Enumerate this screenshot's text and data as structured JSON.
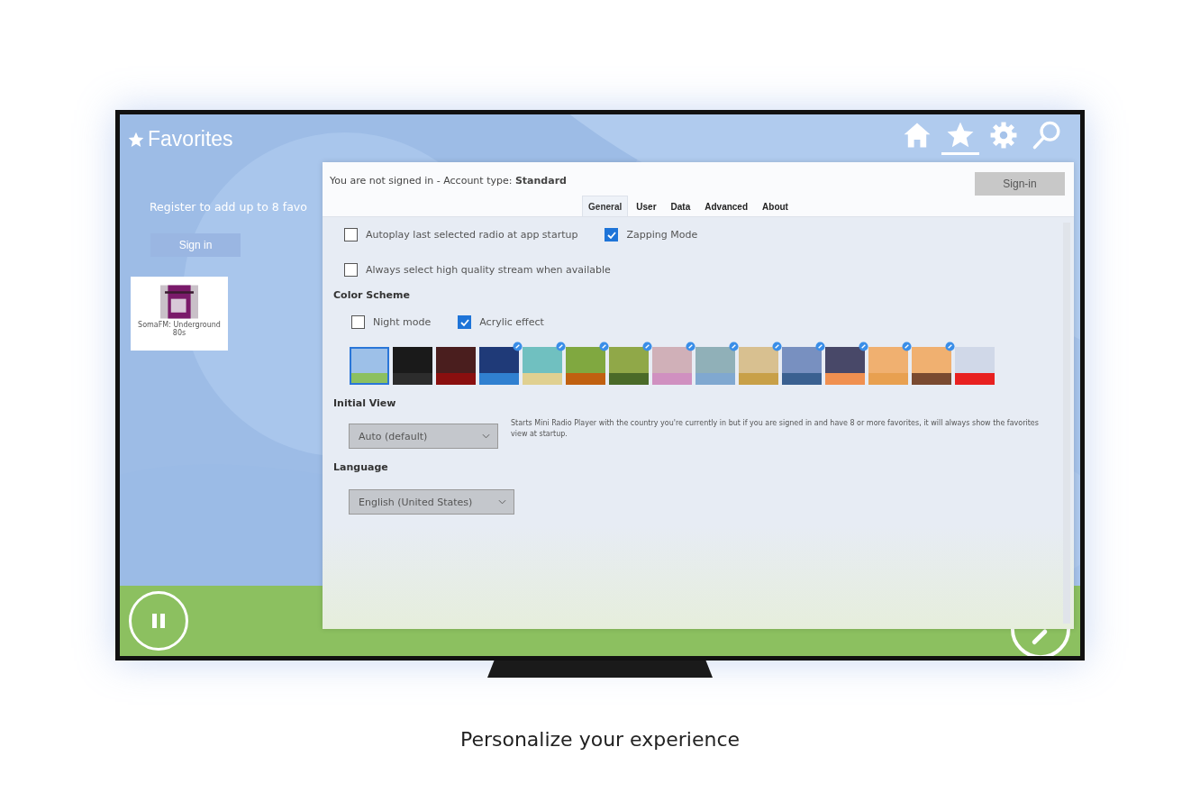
{
  "app": {
    "title": "Favorites",
    "nav": [
      {
        "kind": "home",
        "selected": false
      },
      {
        "kind": "star",
        "selected": true
      },
      {
        "kind": "gear",
        "selected": false
      },
      {
        "kind": "search",
        "selected": false
      }
    ],
    "register_text": "Register to add up to 8 favo",
    "sign_in": "Sign in",
    "favorites": [
      {
        "name": "SomaFM: Underground 80s"
      }
    ],
    "player": {
      "playing": true
    }
  },
  "settings": {
    "status": "You are not signed in - Account type: **Standard**",
    "sign_in": "Sign-in",
    "tabs": [
      {
        "label": "General",
        "selected": true
      },
      {
        "label": "User",
        "selected": false
      },
      {
        "label": "Data",
        "selected": false
      },
      {
        "label": "Advanced",
        "selected": false
      },
      {
        "label": "About",
        "selected": false
      }
    ],
    "options": [
      {
        "label": "Autoplay last selected radio at app startup",
        "checked": false
      },
      {
        "label": "Zapping Mode",
        "checked": true
      },
      {
        "label": "Always select high quality stream when available",
        "checked": false
      }
    ],
    "color_scheme": {
      "heading": "Color Scheme",
      "options": [
        {
          "label": "Night mode",
          "checked": false
        },
        {
          "label": "Acrylic effect",
          "checked": true
        }
      ],
      "swatches": [
        {
          "color": "#9dc0e8",
          "stripe": {
            "color": "#8cc060"
          },
          "selected": true,
          "custom": false
        },
        {
          "color": "#1a1a1a",
          "stripe": {
            "color": "#2c2c2c"
          },
          "selected": false,
          "custom": false
        },
        {
          "color": "#4a1e1e",
          "stripe": {
            "color": "#8a0f0f"
          },
          "selected": false,
          "custom": false
        },
        {
          "color": "#1f3a78",
          "stripe": {
            "color": "#3080d0"
          },
          "selected": false,
          "custom": true
        },
        {
          "color": "#70c0c0",
          "stripe": {
            "color": "#e0d090"
          },
          "selected": false,
          "custom": true
        },
        {
          "color": "#80a840",
          "stripe": {
            "color": "#c06010"
          },
          "selected": false,
          "custom": true
        },
        {
          "color": "#90a848",
          "stripe": {
            "color": "#4a6a28"
          },
          "selected": false,
          "custom": true
        },
        {
          "color": "#d0b0b8",
          "stripe": {
            "color": "#d090c0"
          },
          "selected": false,
          "custom": true
        },
        {
          "color": "#90b0b8",
          "stripe": {
            "color": "#80a8d0"
          },
          "selected": false,
          "custom": true
        },
        {
          "color": "#d8c090",
          "stripe": {
            "color": "#c8a048"
          },
          "selected": false,
          "custom": true
        },
        {
          "color": "#7890c0",
          "stripe": {
            "color": "#3a6090"
          },
          "selected": false,
          "custom": true
        },
        {
          "color": "#484868",
          "stripe": {
            "color": "#f09050"
          },
          "selected": false,
          "custom": true
        },
        {
          "color": "#f0b070",
          "stripe": {
            "color": "#e8a050"
          },
          "selected": false,
          "custom": true
        },
        {
          "color": "#f0b070",
          "stripe": {
            "color": "#7a4a30"
          },
          "selected": false,
          "custom": true
        },
        {
          "color": "#d0d8e8",
          "stripe": {
            "color": "#e82020"
          },
          "selected": false,
          "custom": false
        }
      ]
    },
    "initial_view": {
      "heading": "Initial View",
      "value": "Auto (default)",
      "note": "Starts Mini Radio Player with the country you're currently in but if you are signed in and have 8 or more favorites, it will always show the favorites view at startup."
    },
    "language": {
      "heading": "Language",
      "value": "English (United States)"
    }
  },
  "caption": "Personalize your experience"
}
